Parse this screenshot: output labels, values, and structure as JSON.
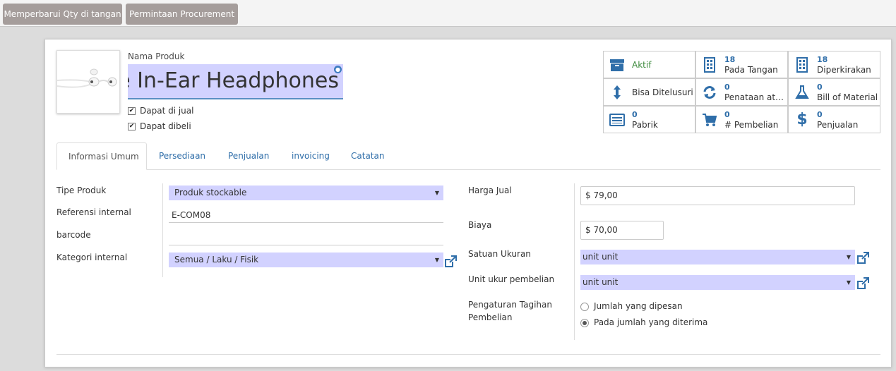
{
  "toolbar": {
    "update_qty_label": "Memperbarui Qty di tangan",
    "procurement_label": "Permintaan Procurement"
  },
  "product": {
    "name_label": "Nama Produk",
    "name_value": "Apple In-Ear Headphones",
    "can_sell_label": "Dapat di jual",
    "can_buy_label": "Dapat dibeli"
  },
  "stats": {
    "active": {
      "label": "Aktif"
    },
    "on_hand": {
      "value": "18",
      "label": "Pada Tangan"
    },
    "forecast": {
      "value": "18",
      "label": "Diperkirakan"
    },
    "traceable": {
      "label": "Bisa Ditelusuri"
    },
    "reordering": {
      "value": "0",
      "label": "Penataan atur..."
    },
    "bom": {
      "value": "0",
      "label": "Bill of Material"
    },
    "factory": {
      "value": "0",
      "label": "Pabrik"
    },
    "purchases": {
      "value": "0",
      "label": "# Pembelian"
    },
    "sales": {
      "value": "0",
      "label": "Penjualan"
    }
  },
  "tabs": [
    {
      "label": "Informasi Umum",
      "active": true
    },
    {
      "label": "Persediaan"
    },
    {
      "label": "Penjualan"
    },
    {
      "label": "invoicing"
    },
    {
      "label": "Catatan"
    }
  ],
  "left_fields": {
    "product_type_label": "Tipe Produk",
    "product_type_value": "Produk stockable",
    "internal_ref_label": "Referensi internal",
    "internal_ref_value": "E-COM08",
    "barcode_label": "barcode",
    "barcode_value": "",
    "category_label": "Kategori internal",
    "category_value": "Semua / Laku / Fisik"
  },
  "right_fields": {
    "sale_price_label": "Harga Jual",
    "sale_price_value": "$ 79,00",
    "cost_label": "Biaya",
    "cost_value": "$ 70,00",
    "uom_label": "Satuan Ukuran",
    "uom_value": "unit unit",
    "purchase_uom_label": "Unit ukur pembelian",
    "purchase_uom_value": "unit unit",
    "billing_label_line1": "Pengaturan Tagihan",
    "billing_label_line2": "Pembelian",
    "billing_opt1": "Jumlah yang dipesan",
    "billing_opt2": "Pada jumlah yang diterima",
    "billing_selected": "Pada jumlah yang diterima"
  },
  "colors": {
    "accent": "#2f6ea9",
    "highlight_field": "#d2d2ff",
    "button_bg": "#a59d9b",
    "active_green": "#3c8a3c"
  },
  "icons": {
    "active": "archive-icon",
    "on_hand": "building-icon",
    "forecast": "building-icon",
    "traceable": "arrows-vertical-icon",
    "reordering": "refresh-icon",
    "bom": "flask-icon",
    "factory": "list-icon",
    "purchases": "cart-icon",
    "sales": "dollar-icon"
  }
}
